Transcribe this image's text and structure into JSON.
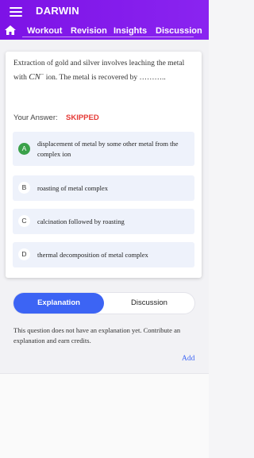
{
  "app": {
    "title": "DARWIN"
  },
  "icons": {
    "menu": "hamburger-menu-icon",
    "home": "home-icon"
  },
  "colors": {
    "appbar": "#8a24f0",
    "accent": "#3c64f4",
    "skipped": "#e53935",
    "correct": "#3aa14a"
  },
  "nav": {
    "items": [
      {
        "label": "Workout"
      },
      {
        "label": "Revision"
      },
      {
        "label": "Insights"
      },
      {
        "label": "Discussion"
      }
    ]
  },
  "question": {
    "text_before": "Extraction of gold and silver involves leaching the metal with ",
    "math": "CN",
    "math_sup": "−",
    "text_after": " ion. The metal is recovered by ………..",
    "your_answer_label": "Your Answer:",
    "status": "SKIPPED"
  },
  "options": [
    {
      "badge": "A",
      "text": "displacement of metal by some other metal from the complex ion",
      "correct": true
    },
    {
      "badge": "B",
      "text": "roasting of metal complex"
    },
    {
      "badge": "C",
      "text": "calcination followed by roasting"
    },
    {
      "badge": "D",
      "text": "thermal decomposition of metal complex"
    }
  ],
  "tabs": {
    "active": "Explanation",
    "inactive": "Discussion"
  },
  "explanation": {
    "text": "This question does not have an explanation yet. Contribute an explanation and earn credits.",
    "add_label": "Add"
  }
}
